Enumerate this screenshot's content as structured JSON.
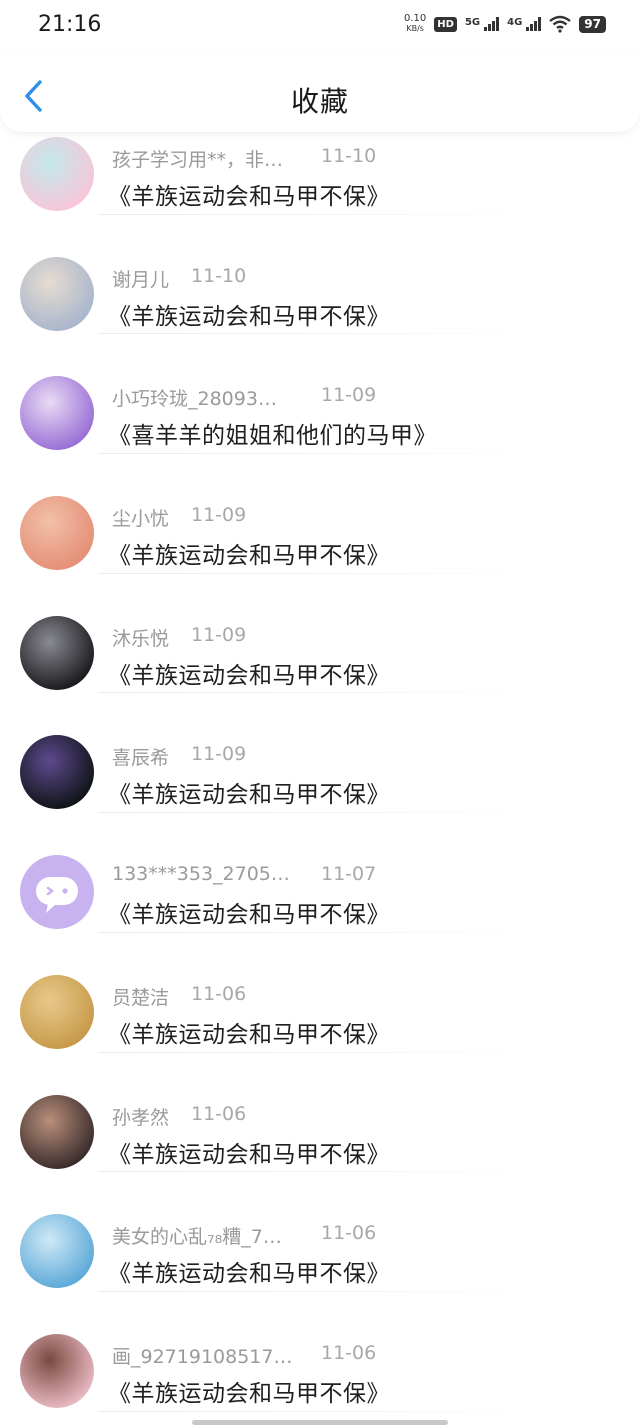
{
  "status_bar": {
    "time": "21:16",
    "net_speed_value": "0.10",
    "net_speed_unit": "KB/s",
    "hd_label": "HD",
    "sim1_label": "5G",
    "sim2_label": "4G",
    "battery": "97"
  },
  "header": {
    "title": "收藏",
    "back_icon": "chevron-left-icon",
    "accent_color": "#2b8fe8"
  },
  "items": [
    {
      "name": "孩子学习用**，非…",
      "date": "11-10",
      "title": "《羊族运动会和马甲不保》",
      "avatar_colors": [
        "#f7c6d9",
        "#c3e9ea"
      ]
    },
    {
      "name": "谢月儿",
      "date": "11-10",
      "title": "《羊族运动会和马甲不保》",
      "avatar_colors": [
        "#a9b6cc",
        "#e6dcd1"
      ]
    },
    {
      "name": "小巧玲珑_28093…",
      "date": "11-09",
      "title": "《喜羊羊的姐姐和他们的马甲》",
      "avatar_colors": [
        "#9a6fd6",
        "#e8dbf4"
      ]
    },
    {
      "name": "尘小忧",
      "date": "11-09",
      "title": "《羊族运动会和马甲不保》",
      "avatar_colors": [
        "#e58f77",
        "#f2c0a8"
      ]
    },
    {
      "name": "沐乐悦",
      "date": "11-09",
      "title": "《羊族运动会和马甲不保》",
      "avatar_colors": [
        "#1b1b1f",
        "#8a8a92"
      ]
    },
    {
      "name": "喜辰希",
      "date": "11-09",
      "title": "《羊族运动会和马甲不保》",
      "avatar_colors": [
        "#101418",
        "#5d4a8e"
      ]
    },
    {
      "name": "133***353_2705…",
      "date": "11-07",
      "title": "《羊族运动会和马甲不保》",
      "avatar_colors": [
        "#c8b3f0",
        "#c8b3f0"
      ]
    },
    {
      "name": "员楚洁",
      "date": "11-06",
      "title": "《羊族运动会和马甲不保》",
      "avatar_colors": [
        "#c79a4a",
        "#e8c98a"
      ]
    },
    {
      "name": "孙孝然",
      "date": "11-06",
      "title": "《羊族运动会和马甲不保》",
      "avatar_colors": [
        "#3a2c2c",
        "#b98f7b"
      ]
    },
    {
      "name": "美女的心乱₇₈糟_7…",
      "date": "11-06",
      "title": "《羊族运动会和马甲不保》",
      "avatar_colors": [
        "#5da9d8",
        "#cfe9f5"
      ]
    },
    {
      "name": "画_92719108517…",
      "date": "11-06",
      "title": "《羊族运动会和马甲不保》",
      "avatar_colors": [
        "#e9b9c3",
        "#7a4a3f"
      ]
    }
  ]
}
